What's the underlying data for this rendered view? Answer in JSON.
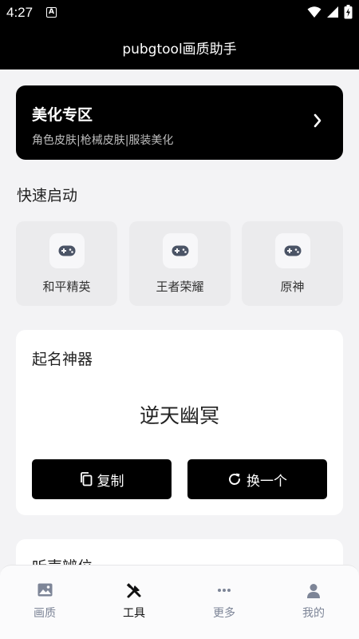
{
  "status": {
    "time": "4:27",
    "notif_glyph": "A"
  },
  "app": {
    "title": "pubgtool画质助手"
  },
  "beauty": {
    "title": "美化专区",
    "subtitle": "角色皮肤|枪械皮肤|服装美化"
  },
  "quick": {
    "title": "快速启动",
    "items": [
      {
        "label": "和平精英",
        "icon": "gamepad-icon"
      },
      {
        "label": "王者荣耀",
        "icon": "gamepad-icon"
      },
      {
        "label": "原神",
        "icon": "gamepad-icon"
      }
    ]
  },
  "namer": {
    "title": "起名神器",
    "value": "逆天幽冥",
    "copy_label": "复制",
    "refresh_label": "换一个"
  },
  "next_section": {
    "title": "听声辨位"
  },
  "tabs": [
    {
      "label": "画质",
      "icon": "image-icon",
      "active": false
    },
    {
      "label": "工具",
      "icon": "tools-icon",
      "active": true
    },
    {
      "label": "更多",
      "icon": "more-icon",
      "active": false
    },
    {
      "label": "我的",
      "icon": "person-icon",
      "active": false
    }
  ],
  "colors": {
    "accent": "#000000",
    "tab_inactive": "#7d8597",
    "background": "#f3f3f5"
  }
}
